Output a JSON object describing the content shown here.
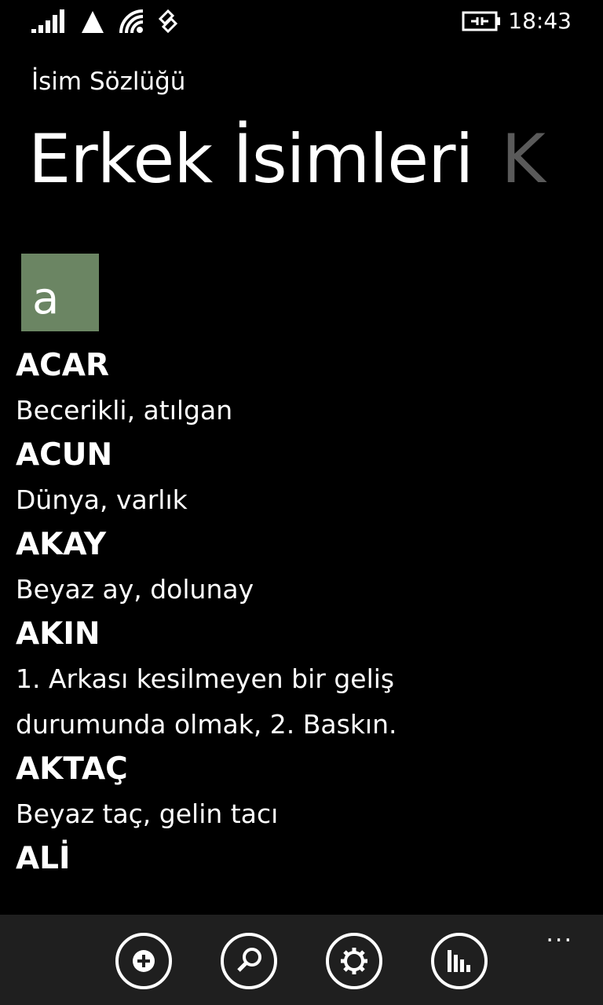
{
  "status": {
    "time": "18:43"
  },
  "app": {
    "title": "İsim Sözlüğü"
  },
  "pivot": {
    "active": "Erkek İsimleri",
    "next": "K"
  },
  "group": {
    "letter": "a"
  },
  "entries": [
    {
      "name": "ACAR",
      "desc": "Becerikli, atılgan"
    },
    {
      "name": "ACUN",
      "desc": "Dünya, varlık"
    },
    {
      "name": "AKAY",
      "desc": "Beyaz ay, dolunay"
    },
    {
      "name": "AKIN",
      "desc_lines": [
        "1. Arkası kesilmeyen bir geliş",
        "durumunda olmak, 2. Baskın."
      ]
    },
    {
      "name": "AKTAÇ",
      "desc": "Beyaz taç, gelin tacı"
    },
    {
      "name": "ALİ"
    }
  ],
  "appbar": {
    "buttons": [
      "add-icon",
      "search-icon",
      "settings-icon",
      "chart-icon"
    ],
    "more": "..."
  }
}
